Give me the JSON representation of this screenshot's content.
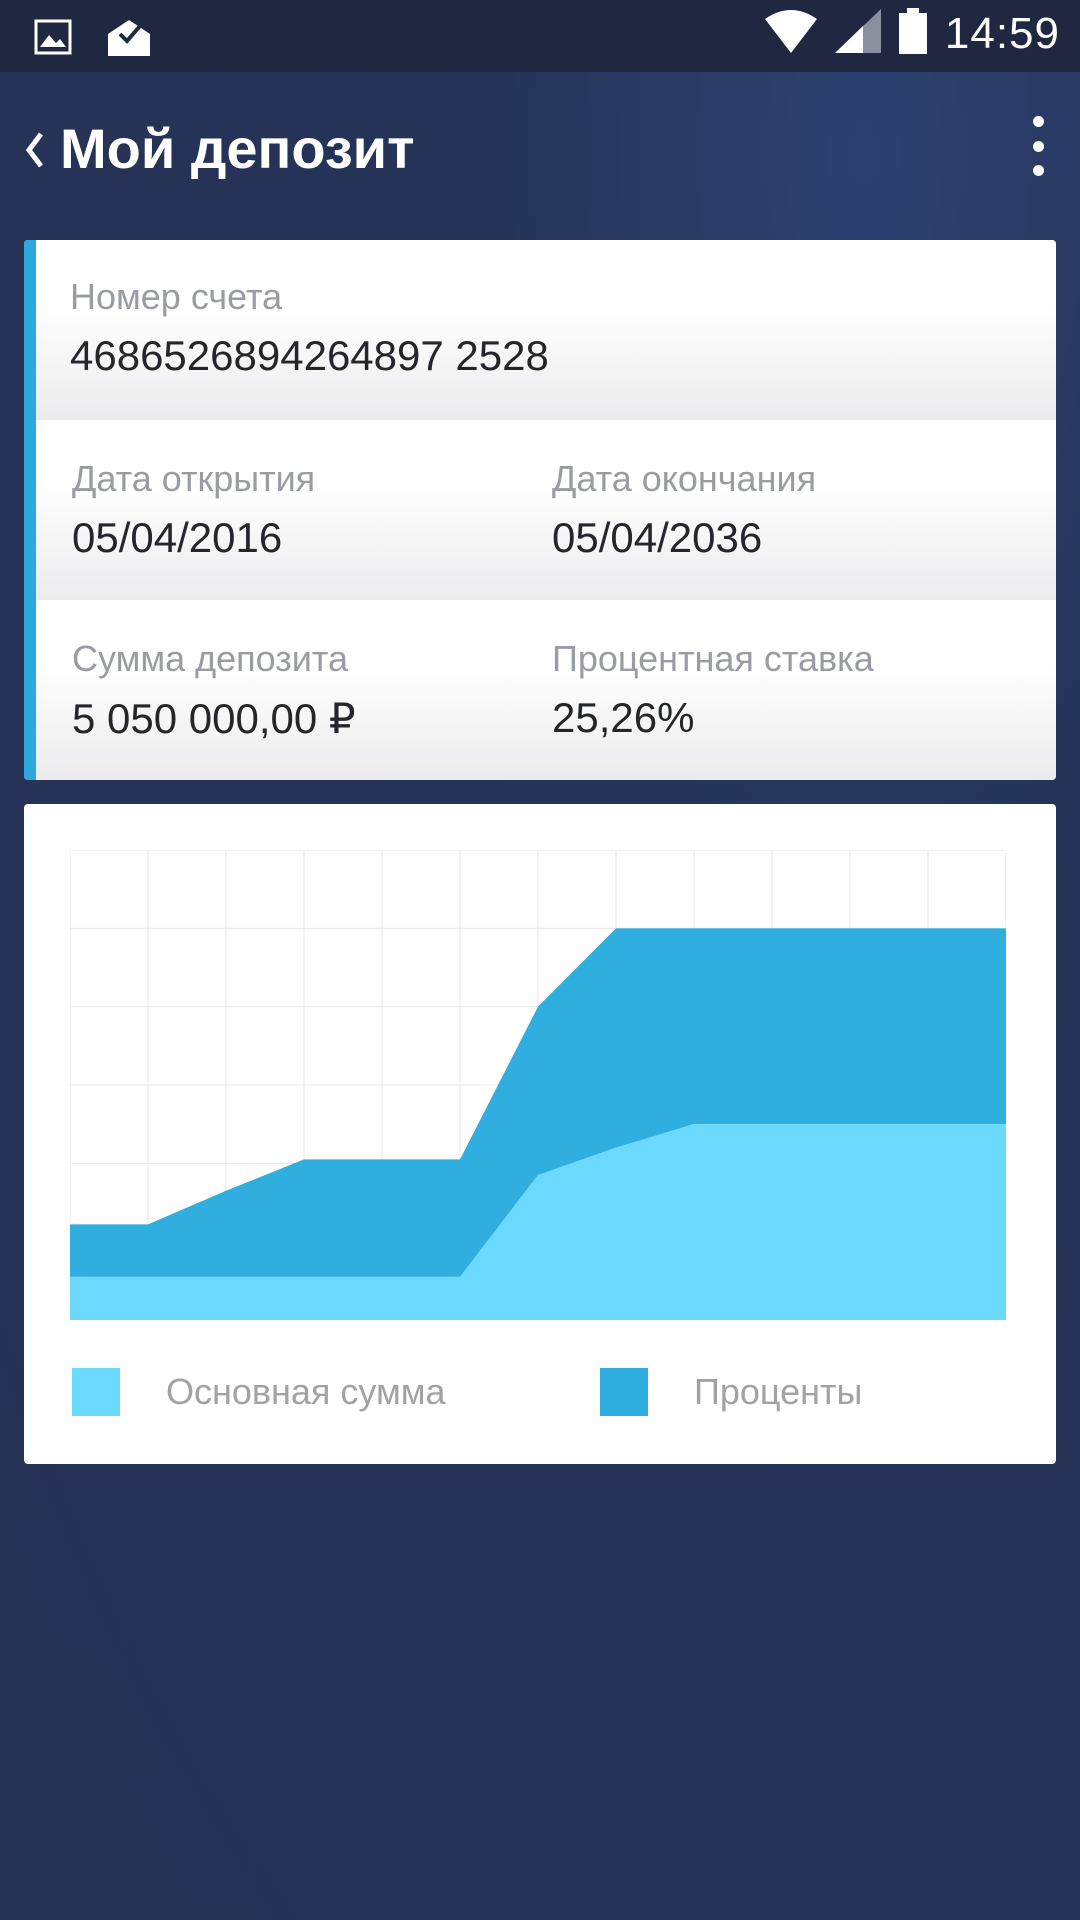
{
  "status_bar": {
    "time": "14:59",
    "icons": [
      "image-icon",
      "mail-check-icon",
      "wifi-icon",
      "signal-icon",
      "battery-icon"
    ]
  },
  "header": {
    "title": "Мой депозит",
    "back_icon": "chevron-left-icon",
    "menu_icon": "more-vert-icon"
  },
  "deposit": {
    "account_label": "Номер счета",
    "account_value": "4686526894264897 2528",
    "open_date_label": "Дата открытия",
    "open_date_value": "05/04/2016",
    "end_date_label": "Дата окончания",
    "end_date_value": "05/04/2036",
    "amount_label": "Сумма депозита",
    "amount_value": "5 050 000,00 ₽",
    "rate_label": "Процентная ставка",
    "rate_value": "25,26%"
  },
  "colors": {
    "principal": "#6bd9fd",
    "interest": "#30aee0",
    "accent": "#2ea9df"
  },
  "legend": {
    "principal_label": "Основная сумма",
    "interest_label": "Проценты"
  },
  "chart_data": {
    "type": "area",
    "stacked": true,
    "x": [
      0,
      1,
      2,
      3,
      4,
      5,
      6,
      7,
      8,
      9,
      10,
      11,
      12
    ],
    "series": [
      {
        "name": "Основная сумма",
        "values": [
          0.55,
          0.55,
          0.55,
          0.55,
          0.55,
          0.55,
          1.85,
          2.2,
          2.5,
          2.5,
          2.5,
          2.5,
          2.5
        ]
      },
      {
        "name": "Проценты",
        "values": [
          0.67,
          0.67,
          1.1,
          1.5,
          1.5,
          1.5,
          2.15,
          2.8,
          2.5,
          2.5,
          2.5,
          2.5,
          2.5
        ]
      }
    ],
    "ylim": [
      0,
      6
    ],
    "xlim": [
      0,
      12
    ],
    "grid": true,
    "legend_position": "bottom"
  }
}
